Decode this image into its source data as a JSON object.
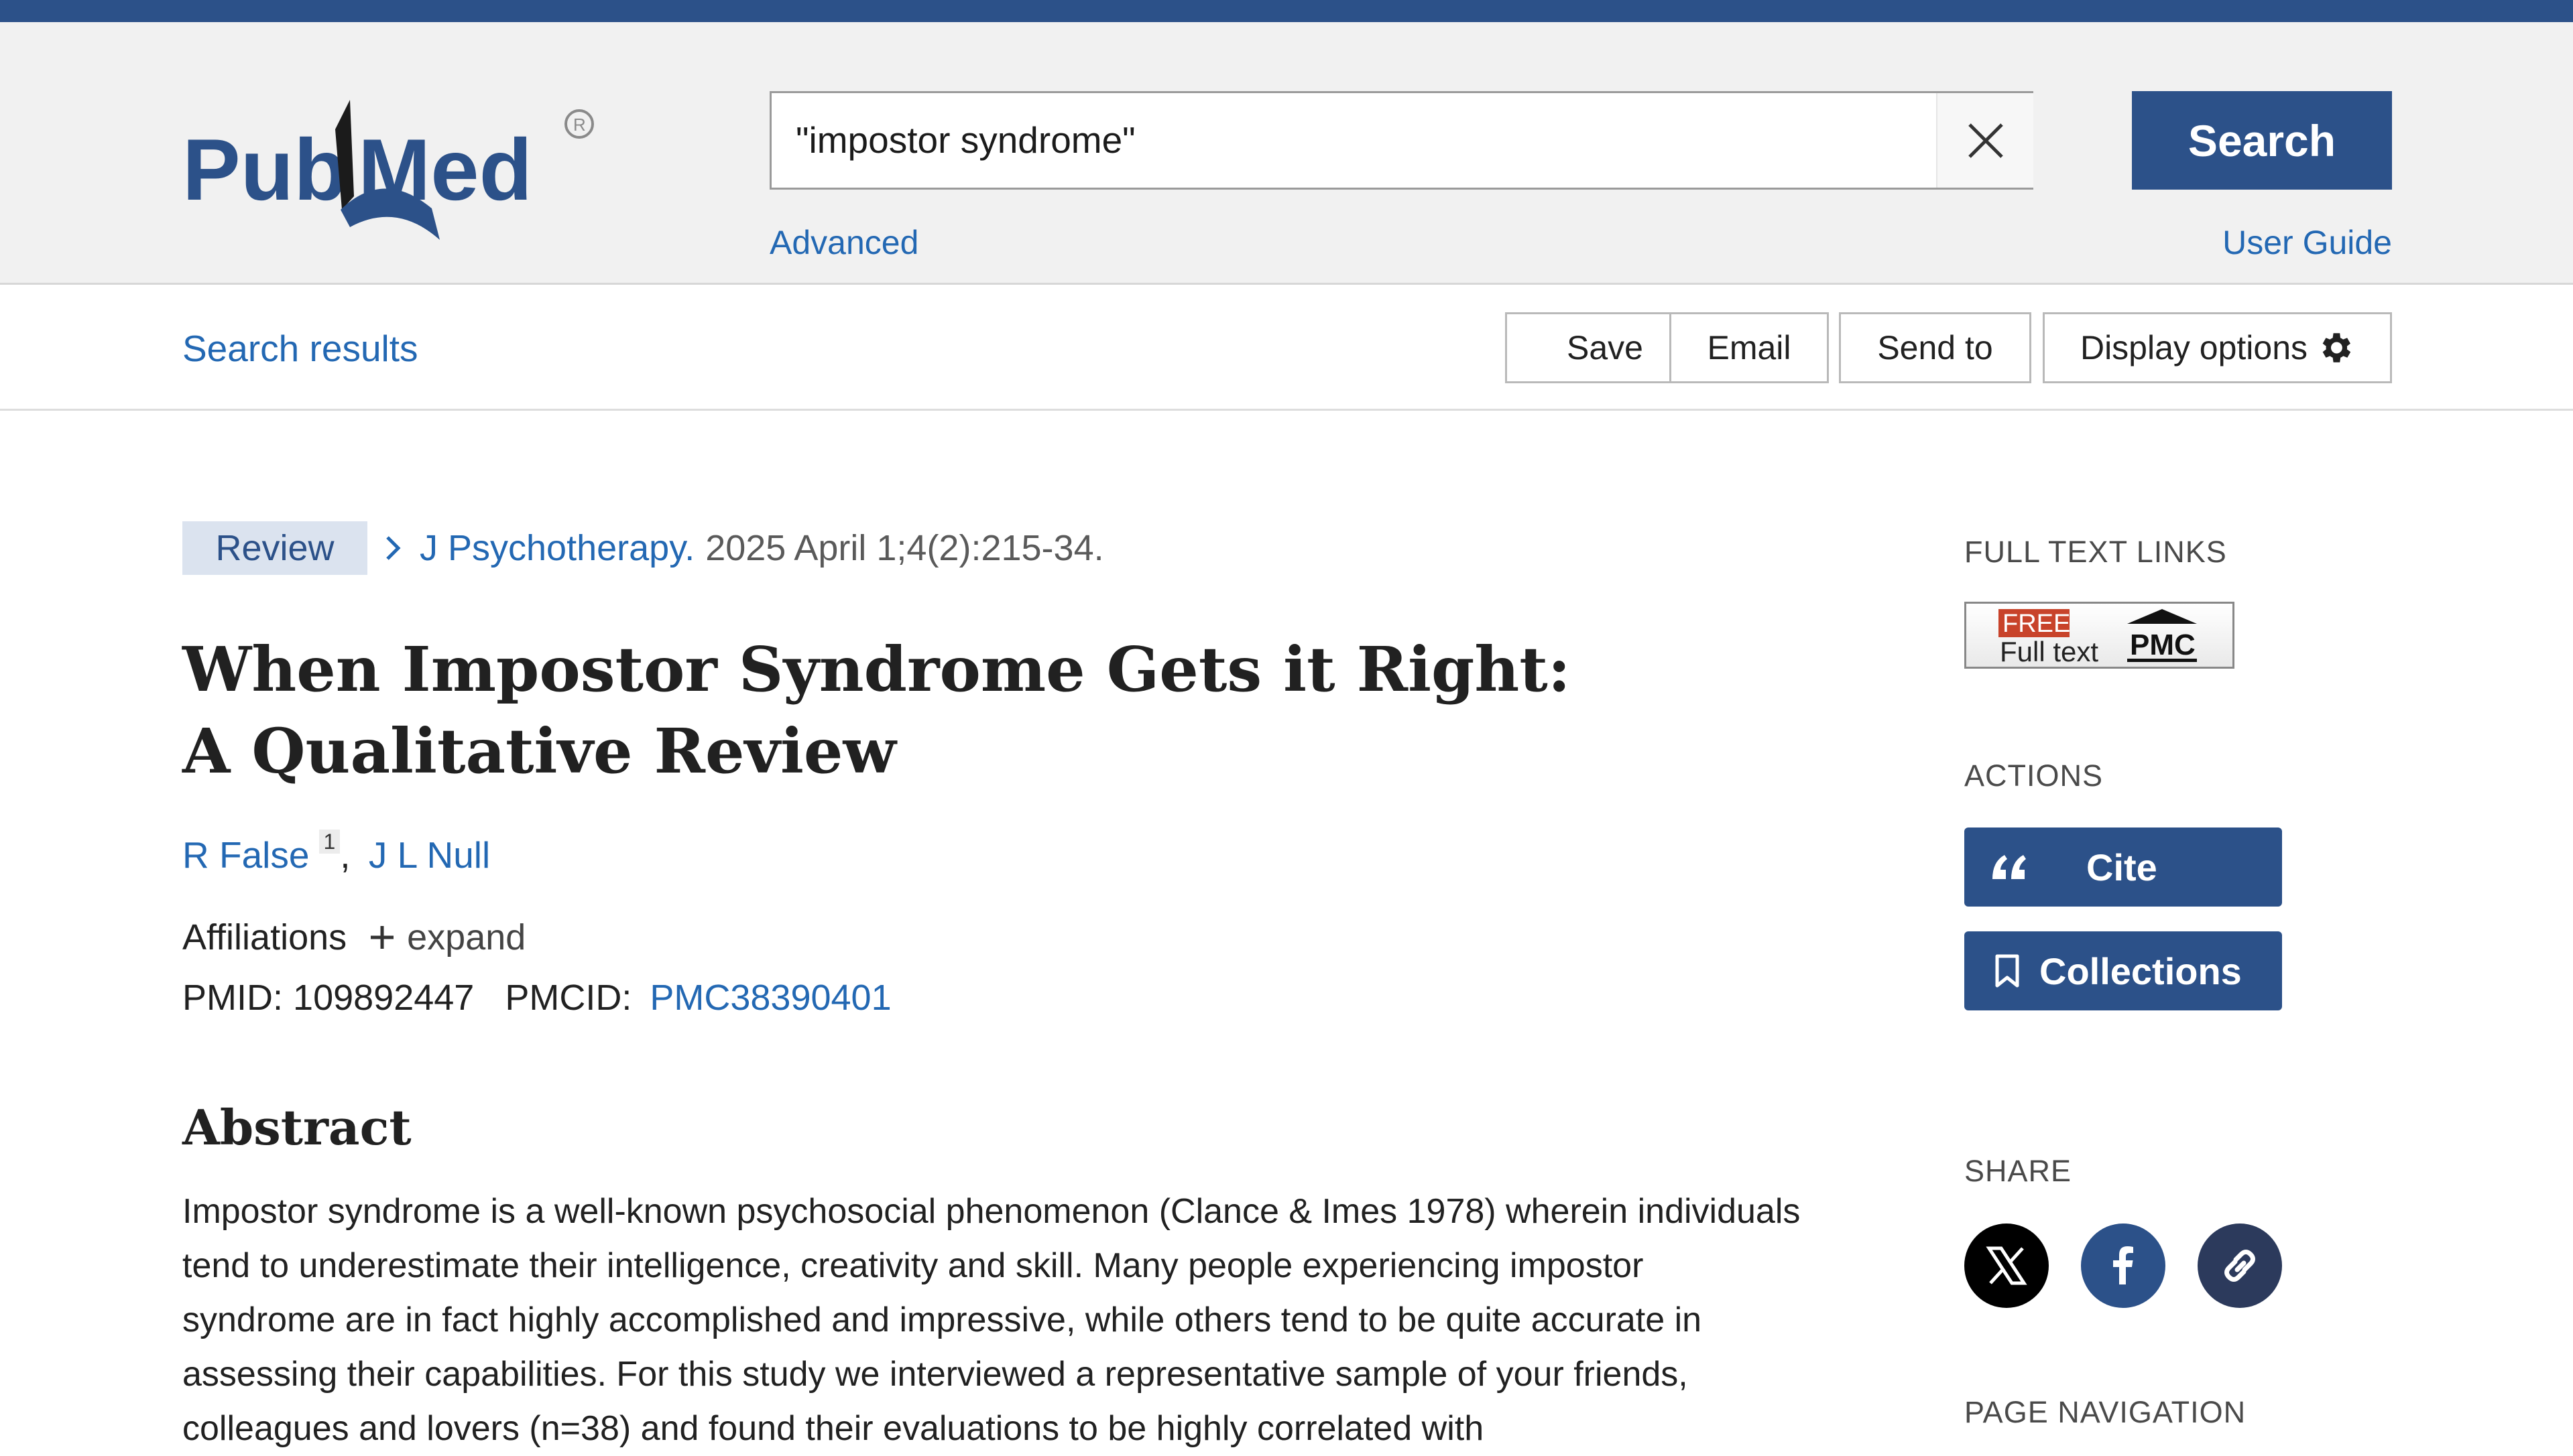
{
  "header": {
    "logo_text": "PubMed",
    "search_value": "\"impostor syndrome\"",
    "search_button": "Search",
    "advanced_link": "Advanced",
    "user_guide_link": "User Guide",
    "brand_color": "#2c5189",
    "link_color": "#2368b3"
  },
  "toolbar": {
    "search_results": "Search results",
    "save": "Save",
    "email": "Email",
    "send_to": "Send to",
    "display_options": "Display options"
  },
  "article": {
    "pub_type": "Review",
    "journal": "J Psychotherapy.",
    "citation_details": "2025 April 1;4(2):215-34.",
    "title_line1": "When Impostor Syndrome Gets it Right:",
    "title_line2": "A Qualitative Review",
    "authors": [
      {
        "name": "R False",
        "affiliation_ref": "1"
      },
      {
        "name": "J L Null"
      }
    ],
    "author_separator": ",",
    "affiliations_label": "Affiliations",
    "expand_label": "expand",
    "pmid_label": "PMID:",
    "pmid": "109892447",
    "pmcid_label": "PMCID:",
    "pmcid": "PMC38390401",
    "abstract_heading": "Abstract",
    "abstract_text": "Impostor syndrome is a well-known psychosocial phenomenon (Clance & Imes 1978) wherein individuals tend to underestimate their intelligence, creativity and skill. Many people experiencing impostor syndrome are in fact highly accomplished and impressive, while others tend to be quite accurate in assessing their capabilities. For this study we interviewed a representative sample of your friends, colleagues and lovers (n=38) and found their evaluations to be highly correlated with"
  },
  "sidebar": {
    "full_text_links": "FULL TEXT LINKS",
    "badge_free": "FREE",
    "badge_full_text": "Full text",
    "badge_pmc": "PMC",
    "actions": "ACTIONS",
    "cite": "Cite",
    "collections": "Collections",
    "share": "SHARE",
    "page_navigation": "PAGE NAVIGATION",
    "share_icons": [
      "x-icon",
      "facebook-icon",
      "link-icon"
    ]
  }
}
